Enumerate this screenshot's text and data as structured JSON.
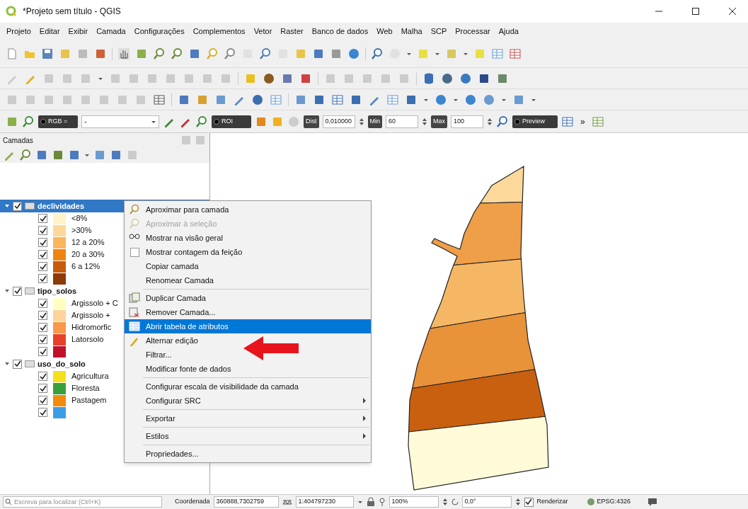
{
  "window": {
    "title": "*Projeto sem título - QGIS"
  },
  "menu": [
    "Projeto",
    "Editar",
    "Exibir",
    "Camada",
    "Configurações",
    "Complementos",
    "Vetor",
    "Raster",
    "Banco de dados",
    "Web",
    "Malha",
    "SCP",
    "Processar",
    "Ajuda"
  ],
  "toolbar_scp": {
    "band_set_button": "RGB =",
    "band_combo": {
      "value": "-"
    },
    "roi_button": "ROI",
    "dist": {
      "label": "Dist",
      "value": "0,010000"
    },
    "min": {
      "label": "Min",
      "value": "60"
    },
    "max": {
      "label": "Max",
      "value": "100"
    },
    "preview_button": "Preview",
    "more_button": "»"
  },
  "layers_panel": {
    "title": "Camadas",
    "layers": [
      {
        "name": "declividades",
        "checked": true,
        "expanded": true,
        "selected": true,
        "children": [
          {
            "label": "<8%",
            "color": "#fff4c8",
            "checked": true
          },
          {
            "label": ">30%",
            "color": "#fdd89c",
            "checked": true
          },
          {
            "label": "12 a 20%",
            "color": "#f9b65e",
            "checked": true
          },
          {
            "label": "20 a 30%",
            "color": "#ee8510",
            "checked": true
          },
          {
            "label": "6 a 12%",
            "color": "#c75a0b",
            "checked": true
          },
          {
            "color": "#8e3a07",
            "checked": true
          }
        ]
      },
      {
        "name": "tipo_solos",
        "checked": true,
        "expanded": true,
        "selected": false,
        "children": [
          {
            "label": "Argissolo + C",
            "color": "#ffffc2",
            "checked": true
          },
          {
            "label": "Argissolo +",
            "color": "#fdd49c",
            "checked": true
          },
          {
            "label": "Hidromorfic",
            "color": "#f9984b",
            "checked": true
          },
          {
            "label": "Latorsolo",
            "color": "#e8412b",
            "checked": true
          },
          {
            "color": "#c3102a",
            "checked": true
          }
        ]
      },
      {
        "name": "uso_do_solo",
        "checked": true,
        "expanded": true,
        "selected": false,
        "children": [
          {
            "label": "Agricultura",
            "color": "#f5e01b",
            "checked": true
          },
          {
            "label": "Floresta",
            "color": "#38a038",
            "checked": true
          },
          {
            "label": "Pastagem",
            "color": "#f28a0c",
            "checked": true
          },
          {
            "color": "#3a9ee4",
            "checked": true
          }
        ]
      }
    ]
  },
  "context_menu": [
    {
      "kind": "zoom",
      "label": "Aproximar para camada",
      "disabled": false,
      "selected": false,
      "submenu": false
    },
    {
      "kind": "zoom",
      "label": "Aproximar à seleção",
      "disabled": true,
      "selected": false,
      "submenu": false
    },
    {
      "kind": "overview",
      "label": "Mostrar na visão geral",
      "disabled": false,
      "selected": false,
      "submenu": false
    },
    {
      "kind": "checkbox",
      "label": "Mostrar contagem da feição",
      "checked": false,
      "disabled": false,
      "selected": false,
      "submenu": false
    },
    {
      "kind": "plain",
      "label": "Copiar camada",
      "disabled": false,
      "selected": false,
      "submenu": false
    },
    {
      "kind": "plain",
      "label": "Renomear Camada",
      "disabled": false,
      "selected": false,
      "submenu": false
    },
    {
      "kind": "separator"
    },
    {
      "kind": "duplicate",
      "label": "Duplicar Camada",
      "disabled": false,
      "selected": false,
      "submenu": false
    },
    {
      "kind": "remove",
      "label": "Remover Camada...",
      "disabled": false,
      "selected": false,
      "submenu": false
    },
    {
      "kind": "table",
      "label": "Abrir tabela de atributos",
      "disabled": false,
      "selected": true,
      "submenu": false
    },
    {
      "kind": "edit",
      "label": "Alternar edição",
      "disabled": false,
      "selected": false,
      "submenu": false
    },
    {
      "kind": "plain",
      "label": "Filtrar...",
      "disabled": false,
      "selected": false,
      "submenu": false
    },
    {
      "kind": "plain",
      "label": "Modificar fonte de dados",
      "disabled": false,
      "selected": false,
      "submenu": false
    },
    {
      "kind": "separator"
    },
    {
      "kind": "plain",
      "label": "Configurar escala de visibilidade da camada",
      "disabled": false,
      "selected": false,
      "submenu": false
    },
    {
      "kind": "plain",
      "label": "Configurar SRC",
      "disabled": false,
      "selected": false,
      "submenu": true
    },
    {
      "kind": "separator"
    },
    {
      "kind": "plain",
      "label": "Exportar",
      "disabled": false,
      "selected": false,
      "submenu": true
    },
    {
      "kind": "separator"
    },
    {
      "kind": "plain",
      "label": "Estilos",
      "disabled": false,
      "selected": false,
      "submenu": true
    },
    {
      "kind": "separator"
    },
    {
      "kind": "plain",
      "label": "Propriedades...",
      "disabled": false,
      "selected": false,
      "submenu": false
    }
  ],
  "status_bar": {
    "search_placeholder": "Escreva para localizar (Ctrl+K)",
    "coordinate_label": "Coordenada",
    "coordinate": "360888,7302759",
    "scale": "1:404797230",
    "magnifier": "100%",
    "rotation": "0,0°",
    "render": {
      "label": "Renderizar",
      "checked": true
    },
    "crs": "EPSG:4326"
  }
}
